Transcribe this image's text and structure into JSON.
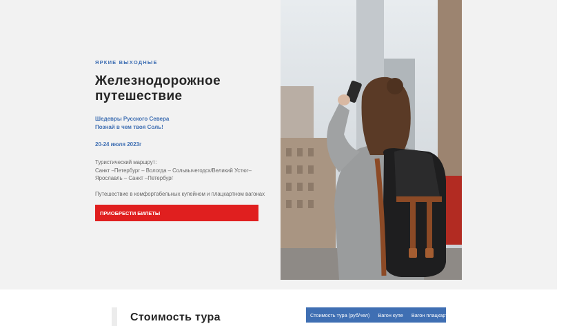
{
  "hero": {
    "eyebrow": "ЯРКИЕ ВЫХОДНЫЕ",
    "title_line1": "Железнодорожное",
    "title_line2": "путешествие",
    "subtitle_line1": "Шедевры Русского Севера",
    "subtitle_line2": "Познай в чем твоя Соль!",
    "dates": "20-24 июля 2023г",
    "route_label": "Туристический маршрут:",
    "route_line1": "Санкт –Петербург – Вологда – Сольвычегодск/Великий Устюг–",
    "route_line2": "Ярославль – Санкт –Петербург",
    "note": "Путешествие в комфортабельных купейном и плацкартном вагонах",
    "cta_label": "ПРИОБРЕСТИ БИЛЕТЫ"
  },
  "pricing": {
    "section_title": "Стоимость тура",
    "table_headers": [
      "Стоимость тура (руб/чел)",
      "Вагон купе",
      "Вагон плацкарт"
    ]
  },
  "colors": {
    "accent_blue": "#3f6fb3",
    "cta_red": "#e01f1f",
    "hero_bg": "#f2f2f2"
  }
}
